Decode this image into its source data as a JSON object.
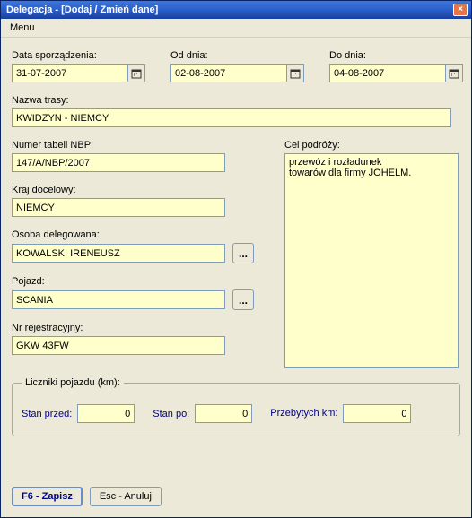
{
  "window": {
    "title": "Delegacja - [Dodaj / Zmień dane]",
    "close": "×"
  },
  "menu": {
    "label": "Menu"
  },
  "fields": {
    "dateCreated": {
      "label": "Data sporządzenia:",
      "value": "31-07-2007"
    },
    "dateFrom": {
      "label": "Od dnia:",
      "value": "02-08-2007"
    },
    "dateTo": {
      "label": "Do dnia:",
      "value": "04-08-2007"
    },
    "routeName": {
      "label": "Nazwa trasy:",
      "value": "KWIDZYN - NIEMCY"
    },
    "nbpTable": {
      "label": "Numer tabeli NBP:",
      "value": "147/A/NBP/2007"
    },
    "destCountry": {
      "label": "Kraj docelowy:",
      "value": "NIEMCY"
    },
    "delegate": {
      "label": "Osoba delegowana:",
      "value": "KOWALSKI IRENEUSZ"
    },
    "vehicle": {
      "label": "Pojazd:",
      "value": "SCANIA"
    },
    "regNumber": {
      "label": "Nr rejestracyjny:",
      "value": "GKW 43FW"
    },
    "tripPurpose": {
      "label": "Cel podróży:",
      "value": "przewóz i rozładunek\ntowarów dla firmy JOHELM."
    }
  },
  "counters": {
    "legend": "Liczniki pojazdu (km):",
    "before": {
      "label": "Stan przed:",
      "value": "0"
    },
    "after": {
      "label": "Stan po:",
      "value": "0"
    },
    "traveled": {
      "label": "Przebytych km:",
      "value": "0"
    }
  },
  "buttons": {
    "save": "F6 - Zapisz",
    "cancel": "Esc - Anuluj",
    "ellipsis": "..."
  }
}
